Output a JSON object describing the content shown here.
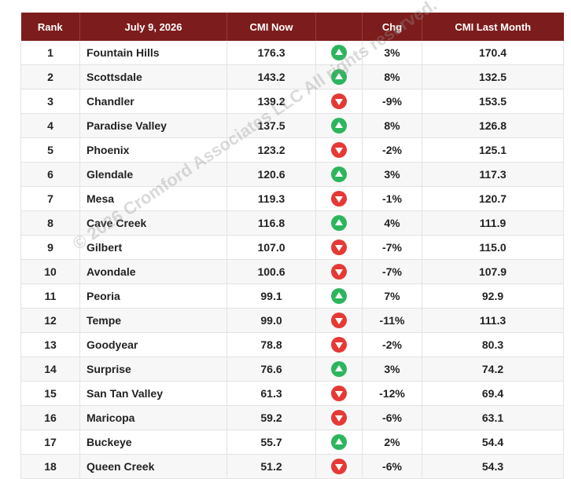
{
  "header": {
    "rank": "Rank",
    "date": "July 9, 2026",
    "cmi_now": "CMI Now",
    "trend": "",
    "chg": "Chg",
    "cmi_last_month": "CMI Last Month"
  },
  "rows": [
    {
      "rank": "1",
      "city": "Fountain Hills",
      "now": "176.3",
      "dir": "up",
      "chg": "3%",
      "last": "170.4"
    },
    {
      "rank": "2",
      "city": "Scottsdale",
      "now": "143.2",
      "dir": "up",
      "chg": "8%",
      "last": "132.5"
    },
    {
      "rank": "3",
      "city": "Chandler",
      "now": "139.2",
      "dir": "down",
      "chg": "-9%",
      "last": "153.5"
    },
    {
      "rank": "4",
      "city": "Paradise Valley",
      "now": "137.5",
      "dir": "up",
      "chg": "8%",
      "last": "126.8"
    },
    {
      "rank": "5",
      "city": "Phoenix",
      "now": "123.2",
      "dir": "down",
      "chg": "-2%",
      "last": "125.1"
    },
    {
      "rank": "6",
      "city": "Glendale",
      "now": "120.6",
      "dir": "up",
      "chg": "3%",
      "last": "117.3"
    },
    {
      "rank": "7",
      "city": "Mesa",
      "now": "119.3",
      "dir": "down",
      "chg": "-1%",
      "last": "120.7"
    },
    {
      "rank": "8",
      "city": "Cave Creek",
      "now": "116.8",
      "dir": "up",
      "chg": "4%",
      "last": "111.9"
    },
    {
      "rank": "9",
      "city": "Gilbert",
      "now": "107.0",
      "dir": "down",
      "chg": "-7%",
      "last": "115.0"
    },
    {
      "rank": "10",
      "city": "Avondale",
      "now": "100.6",
      "dir": "down",
      "chg": "-7%",
      "last": "107.9"
    },
    {
      "rank": "11",
      "city": "Peoria",
      "now": "99.1",
      "dir": "up",
      "chg": "7%",
      "last": "92.9"
    },
    {
      "rank": "12",
      "city": "Tempe",
      "now": "99.0",
      "dir": "down",
      "chg": "-11%",
      "last": "111.3"
    },
    {
      "rank": "13",
      "city": "Goodyear",
      "now": "78.8",
      "dir": "down",
      "chg": "-2%",
      "last": "80.3"
    },
    {
      "rank": "14",
      "city": "Surprise",
      "now": "76.6",
      "dir": "up",
      "chg": "3%",
      "last": "74.2"
    },
    {
      "rank": "15",
      "city": "San Tan Valley",
      "now": "61.3",
      "dir": "down",
      "chg": "-12%",
      "last": "69.4"
    },
    {
      "rank": "16",
      "city": "Maricopa",
      "now": "59.2",
      "dir": "down",
      "chg": "-6%",
      "last": "63.1"
    },
    {
      "rank": "17",
      "city": "Buckeye",
      "now": "55.7",
      "dir": "up",
      "chg": "2%",
      "last": "54.4"
    },
    {
      "rank": "18",
      "city": "Queen Creek",
      "now": "51.2",
      "dir": "down",
      "chg": "-6%",
      "last": "54.3"
    }
  ],
  "icons": {
    "up": "arrow-up-icon",
    "down": "arrow-down-icon"
  },
  "colors": {
    "header_bg": "#7d1c1c",
    "up": "#2db55d",
    "down": "#e53935"
  },
  "watermark": "© 2026 Cromford Associates LLC All rights reserved."
}
